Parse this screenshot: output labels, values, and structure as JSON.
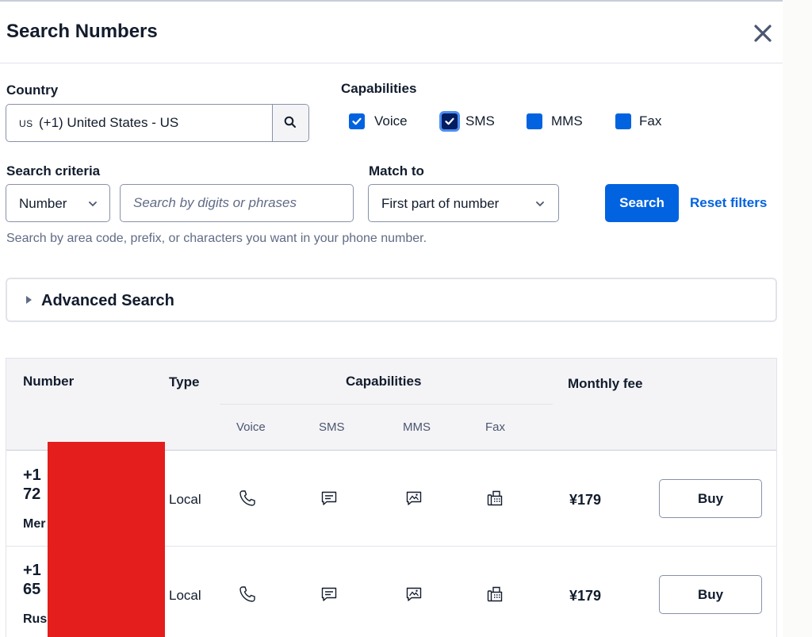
{
  "dialog": {
    "title": "Search Numbers"
  },
  "country": {
    "label": "Country",
    "code": "US",
    "value": "(+1) United States - US"
  },
  "capabilities": {
    "label": "Capabilities",
    "items": [
      {
        "label": "Voice",
        "checked": true
      },
      {
        "label": "SMS",
        "checked": true,
        "focused": true
      },
      {
        "label": "MMS",
        "checked": false
      },
      {
        "label": "Fax",
        "checked": false
      }
    ]
  },
  "criteria": {
    "label": "Search criteria",
    "selected": "Number",
    "placeholder": "Search by digits or phrases"
  },
  "match_to": {
    "label": "Match to",
    "selected": "First part of number"
  },
  "actions": {
    "search_label": "Search",
    "reset_label": "Reset filters"
  },
  "helper_text": "Search by area code, prefix, or characters you want in your phone number.",
  "advanced": {
    "label": "Advanced Search"
  },
  "table": {
    "headers": {
      "number": "Number",
      "type": "Type",
      "capabilities": "Capabilities",
      "fee": "Monthly fee",
      "voice": "Voice",
      "sms": "SMS",
      "mms": "MMS",
      "fax": "Fax"
    },
    "rows": [
      {
        "number_line1": "+1",
        "number_line2": "72",
        "locality": "Mer",
        "type": "Local",
        "fee": "¥179",
        "buy_label": "Buy"
      },
      {
        "number_line1": "+1",
        "number_line2": "65",
        "locality": "Rus",
        "type": "Local",
        "fee": "¥179",
        "buy_label": "Buy"
      }
    ]
  },
  "colors": {
    "primary": "#0263e0",
    "checkbox_focused": "#031d60",
    "redaction": "#e31e1d"
  }
}
